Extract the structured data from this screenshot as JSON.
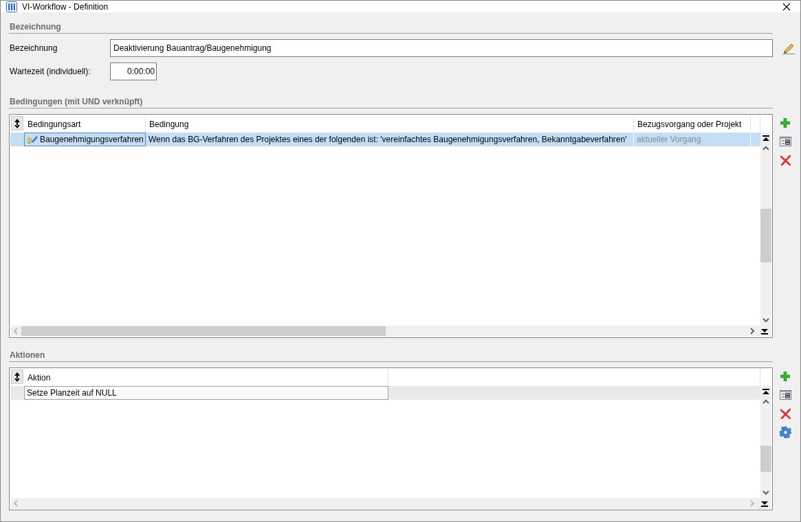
{
  "window": {
    "title": "VI-Workflow - Definition"
  },
  "general": {
    "heading": "Bezeichnung",
    "fields": [
      {
        "kind": "text",
        "label": "Bezeichnung",
        "value": "Deaktivierung Bauantrag/Baugenehmigung"
      },
      {
        "kind": "time",
        "label": "Wartezeit (individuell):",
        "value": "0:00:00"
      }
    ]
  },
  "conditions": {
    "heading": "Bedingungen (mit UND verknüpft)",
    "focused": true,
    "columns": [
      "Bedingungsart",
      "Bedingung",
      "Bezugsvorgang oder Projekt"
    ],
    "rows": [
      {
        "selected": true,
        "cells": [
          {
            "text": "Baugenehmigungsverfahren",
            "greyed": false
          },
          {
            "text": "Wenn das BG-Verfahren des Projektes eines der folgenden ist: 'vereinfachtes Baugenehmigungsverfahren, Bekanntgabeverfahren'",
            "greyed": false
          },
          {
            "text": "aktueller Vorgang",
            "greyed": true
          }
        ]
      }
    ]
  },
  "actions": {
    "heading": "Aktionen",
    "focused": false,
    "columns": [
      "Aktion"
    ],
    "rows": [
      {
        "selected": true,
        "cells": [
          {
            "text": "Setze Planzeit auf NULL",
            "greyed": false
          }
        ]
      }
    ]
  }
}
